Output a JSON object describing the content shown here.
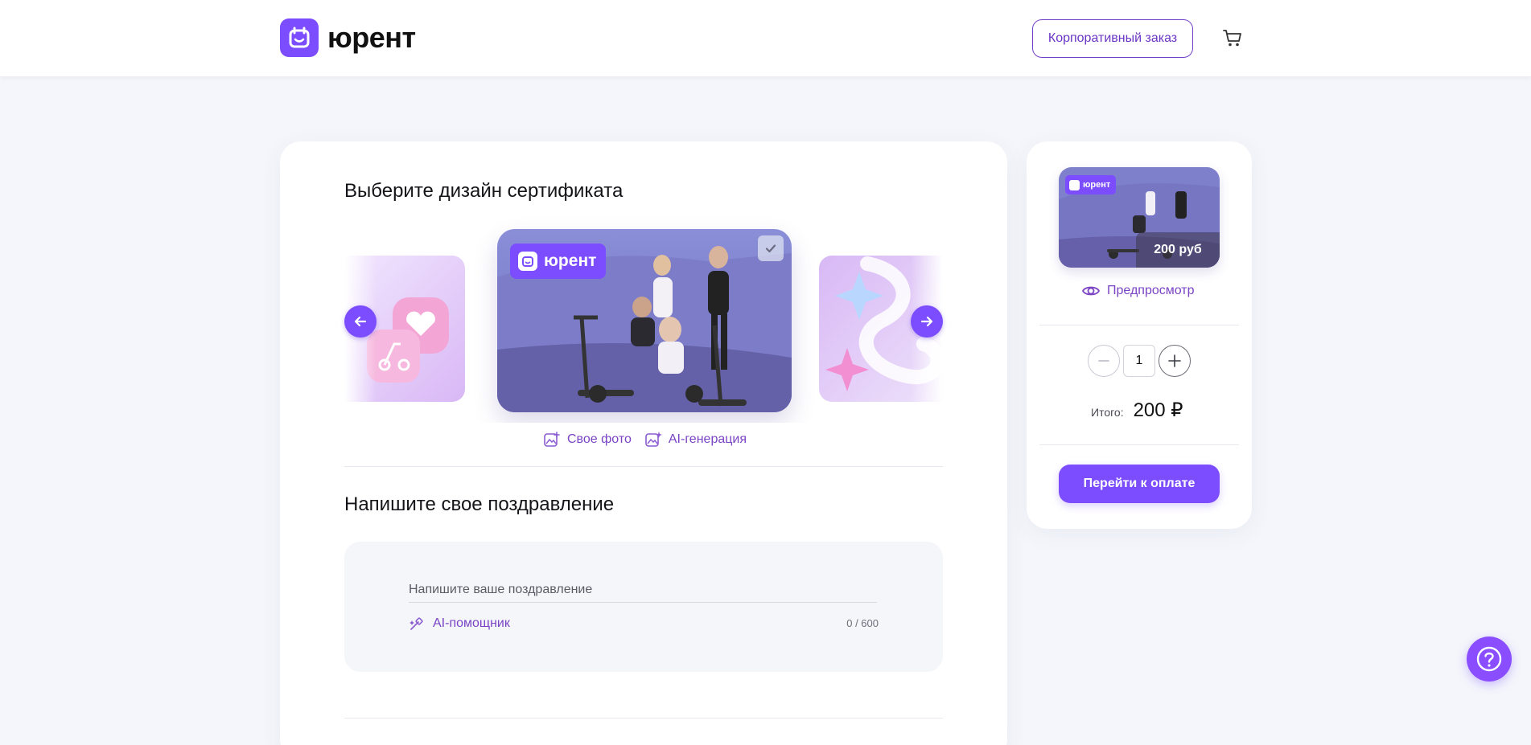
{
  "brand": {
    "name": "юрент",
    "accent": "#7c4dff"
  },
  "header": {
    "corporate_order_label": "Корпоративный заказ",
    "cart_icon": "cart-icon"
  },
  "design_section": {
    "title": "Выберите дизайн сертификата",
    "selected_slide_logo_text": "юрент",
    "prev_icon": "arrow-left-icon",
    "next_icon": "arrow-right-icon",
    "selected_icon": "check-icon",
    "own_photo_label": "Свое фото",
    "ai_generation_label": "AI-генерация"
  },
  "greeting_section": {
    "title": "Напишите свое поздравление",
    "placeholder": "Напишите ваше поздравление",
    "ai_helper_label": "AI-помощник",
    "char_count": "0 / 600"
  },
  "order": {
    "thumb_logo_text": "юрент",
    "thumb_price": "200 руб",
    "preview_label": "Предпросмотр",
    "quantity": "1",
    "total_label": "Итого:",
    "total_value": "200 ₽",
    "pay_label": "Перейти к оплате"
  },
  "help_icon": "question-icon"
}
